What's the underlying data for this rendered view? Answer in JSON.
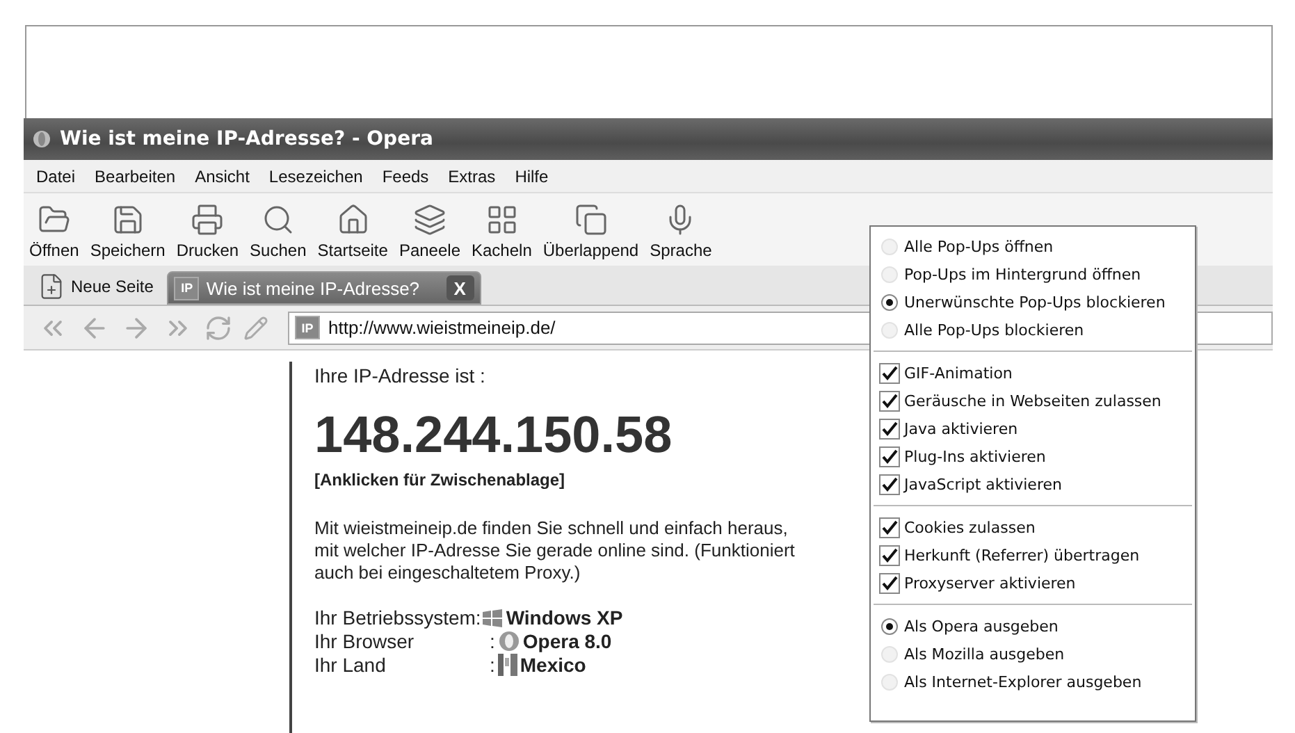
{
  "window": {
    "title": "Wie ist meine IP-Adresse? - Opera"
  },
  "menu_bar": [
    "Datei",
    "Bearbeiten",
    "Ansicht",
    "Lesezeichen",
    "Feeds",
    "Extras",
    "Hilfe"
  ],
  "toolbar": [
    {
      "kind": "open",
      "label": "Öffnen"
    },
    {
      "kind": "save",
      "label": "Speichern"
    },
    {
      "kind": "print",
      "label": "Drucken"
    },
    {
      "kind": "search",
      "label": "Suchen"
    },
    {
      "kind": "home",
      "label": "Startseite"
    },
    {
      "kind": "panels",
      "label": "Paneele"
    },
    {
      "kind": "tile",
      "label": "Kacheln"
    },
    {
      "kind": "cascade",
      "label": "Überlappend"
    },
    {
      "kind": "voice",
      "label": "Sprache"
    }
  ],
  "new_tab": {
    "label": "Neue Seite"
  },
  "tabs": [
    {
      "badge": "IP",
      "label": "Wie ist meine IP-Adresse?",
      "close": "X",
      "selected": true
    }
  ],
  "address_bar": {
    "badge": "IP",
    "value": "http://www.wieistmeineip.de/"
  },
  "page": {
    "intro": "Ihre IP-Adresse ist :",
    "ip": "148.244.150.58",
    "copy_link": "[Anklicken für Zwischenablage]",
    "description": "Mit wieistmeineip.de finden Sie schnell und einfach heraus, mit welcher IP-Adresse Sie gerade online sind. (Funktioniert auch bei eingeschaltetem Proxy.)",
    "info": [
      {
        "kind": "os",
        "label": "Ihr Betriebssystem:",
        "value": "Windows XP"
      },
      {
        "kind": "browser",
        "label": "Ihr Browser",
        "colon": ":",
        "value": "Opera 8.0"
      },
      {
        "kind": "country",
        "label": "Ihr Land",
        "colon": ":",
        "value": "Mexico"
      }
    ]
  },
  "quick_menu": {
    "groups": [
      {
        "items": [
          {
            "kind": "radio",
            "label": "Alle Pop-Ups öffnen",
            "selected": false
          },
          {
            "kind": "radio",
            "label": "Pop-Ups im Hintergrund öffnen",
            "selected": false
          },
          {
            "kind": "radio",
            "label": "Unerwünschte Pop-Ups blockieren",
            "selected": true
          },
          {
            "kind": "radio",
            "label": "Alle Pop-Ups blockieren",
            "selected": false
          }
        ]
      },
      {
        "items": [
          {
            "kind": "check",
            "label": "GIF-Animation",
            "checked": true
          },
          {
            "kind": "check",
            "label": "Geräusche in Webseiten zulassen",
            "checked": true
          },
          {
            "kind": "check",
            "label": "Java aktivieren",
            "checked": true
          },
          {
            "kind": "check",
            "label": "Plug-Ins aktivieren",
            "checked": true
          },
          {
            "kind": "check",
            "label": "JavaScript aktivieren",
            "checked": true
          }
        ]
      },
      {
        "items": [
          {
            "kind": "check",
            "label": "Cookies zulassen",
            "checked": true
          },
          {
            "kind": "check",
            "label": "Herkunft (Referrer) übertragen",
            "checked": true
          },
          {
            "kind": "check",
            "label": "Proxyserver aktivieren",
            "checked": true
          }
        ]
      },
      {
        "items": [
          {
            "kind": "radio",
            "label": "Als Opera ausgeben",
            "selected": true
          },
          {
            "kind": "radio",
            "label": "Als Mozilla ausgeben",
            "selected": false
          },
          {
            "kind": "radio",
            "label": "Als Internet-Explorer ausgeben",
            "selected": false
          }
        ]
      }
    ]
  }
}
